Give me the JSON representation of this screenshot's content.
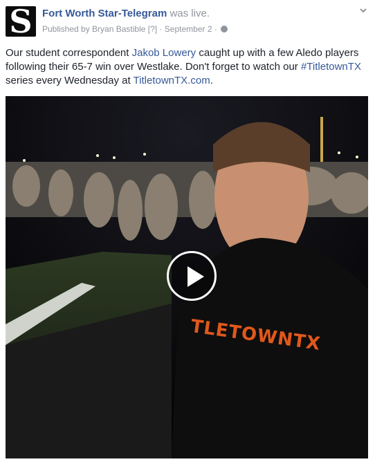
{
  "post": {
    "page_name": "Fort Worth Star-Telegram",
    "status": "was live.",
    "published_by": "Published by Bryan Bastible",
    "help_marker": "[?]",
    "separator": "·",
    "date": "September 2",
    "privacy_icon": "globe-icon",
    "menu_icon": "chevron-down-icon",
    "avatar_letter": "S"
  },
  "message": {
    "part1": "Our student correspondent ",
    "mention": "Jakob Lowery",
    "part2": " caught up with a few Aledo players following their 65-7 win over Westlake. Don't forget to watch our ",
    "hashtag": "#TitletownTX",
    "part3": " series every Wednesday at ",
    "url": "TitletownTX.com",
    "part4": "."
  },
  "video": {
    "shirt_text": "TLETOWNTX",
    "play_icon": "play-icon"
  },
  "colors": {
    "link": "#365899",
    "meta": "#90949c",
    "text": "#1d2129",
    "shirt": "#e0581c"
  }
}
